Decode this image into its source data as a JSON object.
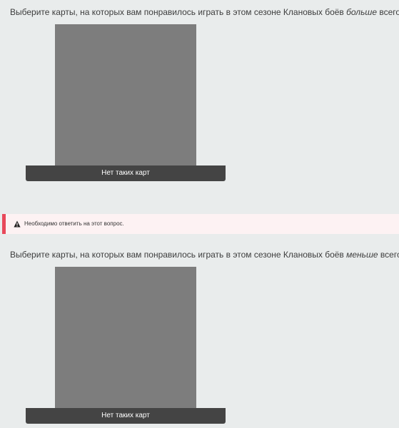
{
  "questions": [
    {
      "text_before": "Выберите карты, на которых вам понравилось играть в этом сезоне Клановых боёв ",
      "text_emphasis": "больше",
      "text_after": " всего.",
      "required_mark": "*",
      "choice_label": "Нет таких карт"
    },
    {
      "text_before": "Выберите карты, на которых вам понравилось играть в этом сезоне Клановых боёв ",
      "text_emphasis": "меньше",
      "text_after": " всего.",
      "required_mark": "*",
      "choice_label": "Нет таких карт"
    }
  ],
  "error": {
    "icon": "warning-icon",
    "message": "Необходимо ответить на этот вопрос."
  },
  "colors": {
    "background": "#e9ecec",
    "required": "#c8102e",
    "error_accent": "#e8485a",
    "error_background": "#fdf2f3",
    "button": "#444444",
    "image_placeholder": "#7d7d7d"
  }
}
